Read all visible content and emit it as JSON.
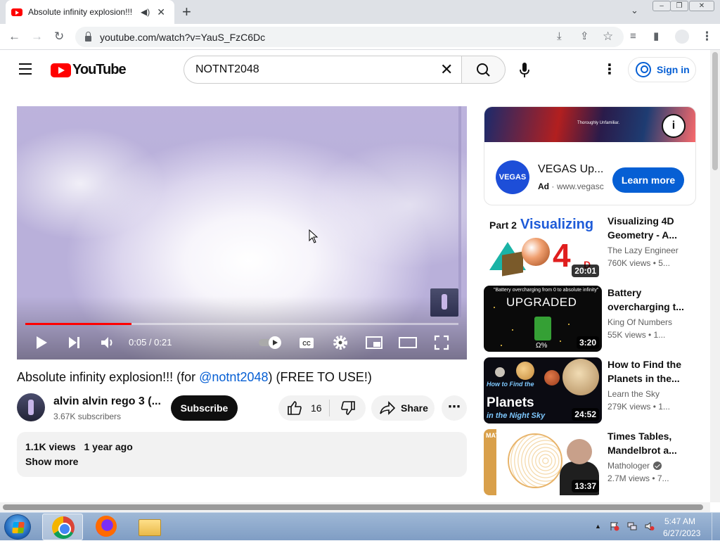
{
  "browser": {
    "tab_title": "Absolute infinity explosion!!!",
    "url": "youtube.com/watch?v=YauS_FzC6Dc"
  },
  "header": {
    "logo_text": "YouTube",
    "search_value": "NOTNT2048",
    "sign_in_label": "Sign in"
  },
  "player": {
    "time_current": "0:05",
    "time_total": "0:21",
    "time_display": "0:05 / 0:21",
    "progress_fraction": 0.245,
    "accent_color": "#ff0000"
  },
  "video": {
    "title_prefix": "Absolute infinity explosion!!! (for ",
    "title_mention": "@notnt2048",
    "title_suffix": ") (FREE TO USE!)",
    "channel_name": "alvin alvin rego 3 (...",
    "subscribers": "3.67K subscribers",
    "subscribe_label": "Subscribe",
    "like_count": "16",
    "share_label": "Share",
    "views": "1.1K views",
    "age": "1 year ago",
    "show_more_label": "Show more"
  },
  "ad": {
    "banner_text": "Thoroughly Unfamiliar.",
    "logo_text": "VEGAS",
    "title": "VEGAS Up...",
    "badge": "Ad",
    "separator": "·",
    "url": "www.vegasc",
    "cta_label": "Learn more",
    "cta_color": "#065fd4"
  },
  "recommendations": [
    {
      "title_line1": "Visualizing 4D",
      "title_line2": "Geometry - A...",
      "channel": "The Lazy Engineer",
      "meta": "760K views  •  5...",
      "duration": "20:01",
      "thumb_text_1": "Part 2",
      "thumb_text_2": "Visualizing",
      "thumb_text_3": "4",
      "thumb_text_4": "D"
    },
    {
      "title_line1": "Battery",
      "title_line2": "overcharging t...",
      "channel": "King Of Numbers",
      "meta": "55K views  •  1...",
      "duration": "3:20",
      "thumb_text_1": "\"Battery overcharging from 0 to absolute infinity\"",
      "thumb_text_2": "UPGRADED",
      "thumb_text_3": "Ω%"
    },
    {
      "title_line1": "How to Find the",
      "title_line2": "Planets in the...",
      "channel": "Learn the Sky",
      "meta": "279K views  •  1...",
      "duration": "24:52",
      "thumb_text_1": "How to Find the",
      "thumb_text_2": "Planets",
      "thumb_text_3": "in the Night Sky"
    },
    {
      "title_line1": "Times Tables,",
      "title_line2": "Mandelbrot a...",
      "channel": "Mathologer",
      "meta": "2.7M views  •  7...",
      "duration": "13:37",
      "thumb_text_1": "MATHOLOGER"
    }
  ],
  "taskbar": {
    "time": "5:47 AM",
    "date": "6/27/2023"
  },
  "icons": {
    "back": "arrow-left-icon",
    "forward": "arrow-right-icon",
    "reload": "reload-icon",
    "search": "search-icon",
    "mic": "microphone-icon",
    "play": "play-icon",
    "settings": "gear-icon"
  }
}
